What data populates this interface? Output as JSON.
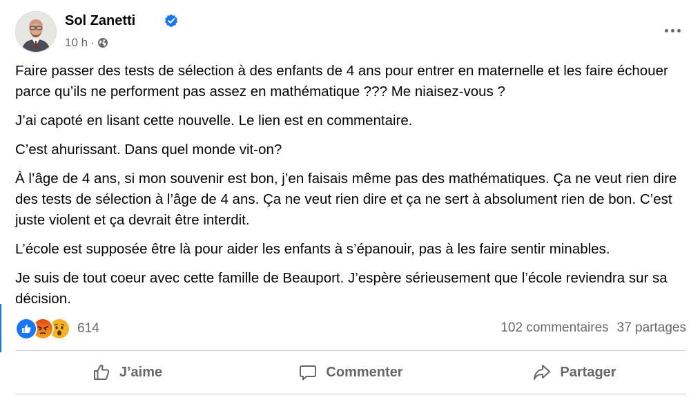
{
  "post": {
    "author": "Sol Zanetti",
    "timestamp": "10 h",
    "separator": "·",
    "audience_icon": "globe-icon",
    "paragraphs": [
      "Faire passer des tests de sélection à des enfants de 4 ans pour entrer en maternelle et les faire échouer parce qu’ils ne performent pas assez en mathématique ??? Me niaisez-vous ?",
      "J’ai capoté en lisant cette nouvelle. Le lien est en commentaire.",
      "C’est ahurissant. Dans quel monde vit-on?",
      "À l’âge de 4 ans, si mon souvenir est bon, j’en faisais même pas des mathématiques. Ça ne veut rien dire des tests de sélection à l’âge de 4 ans. Ça ne veut rien dire et ça ne sert à absolument rien de bon. C’est juste violent et ça devrait être interdit.",
      "L’école est supposée être là pour aider les enfants à s’épanouir, pas à les faire sentir minables.",
      "Je suis de tout coeur avec cette famille de Beauport. J’espère sérieusement que l’école reviendra sur sa décision."
    ]
  },
  "reactions": {
    "icons": [
      "like-icon",
      "angry-icon",
      "wow-icon"
    ],
    "count": "614"
  },
  "stats": {
    "comments": "102 commentaires",
    "shares": "37 partages"
  },
  "actions": {
    "like": "J’aime",
    "comment": "Commenter",
    "share": "Partager"
  },
  "colors": {
    "accent": "#1b74e4",
    "secondary_text": "#65676b",
    "like_blue": "#1877f2",
    "angry_orange": "#e9710f",
    "wow_yellow": "#f7b125"
  }
}
